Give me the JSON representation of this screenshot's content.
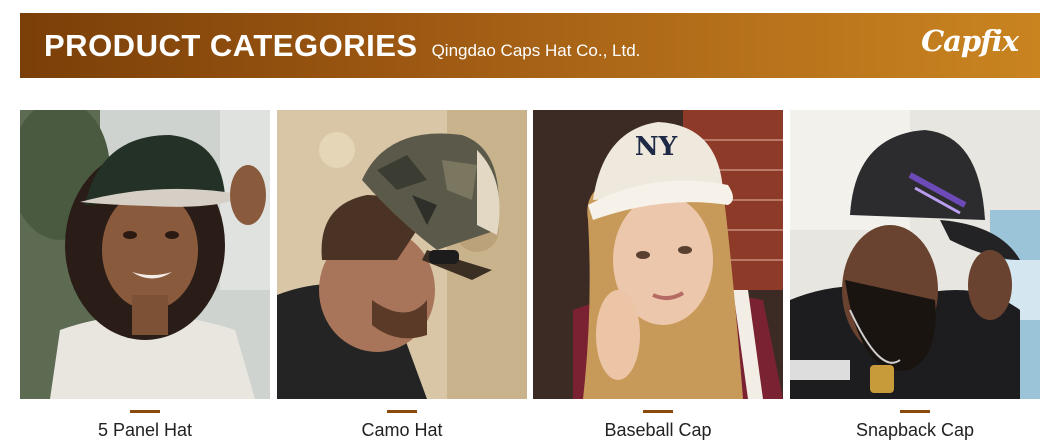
{
  "banner": {
    "title": "PRODUCT CATEGORIES",
    "subtitle": "Qingdao Caps Hat Co., Ltd.",
    "logo_text": "Capfix"
  },
  "colors": {
    "banner_start": "#7a3f08",
    "banner_end": "#c98420",
    "accent_dash": "#8b4a0d"
  },
  "categories": [
    {
      "label": "5 Panel Hat"
    },
    {
      "label": "Camo Hat"
    },
    {
      "label": "Baseball Cap",
      "cap_logo": "NY"
    },
    {
      "label": "Snapback Cap"
    }
  ]
}
